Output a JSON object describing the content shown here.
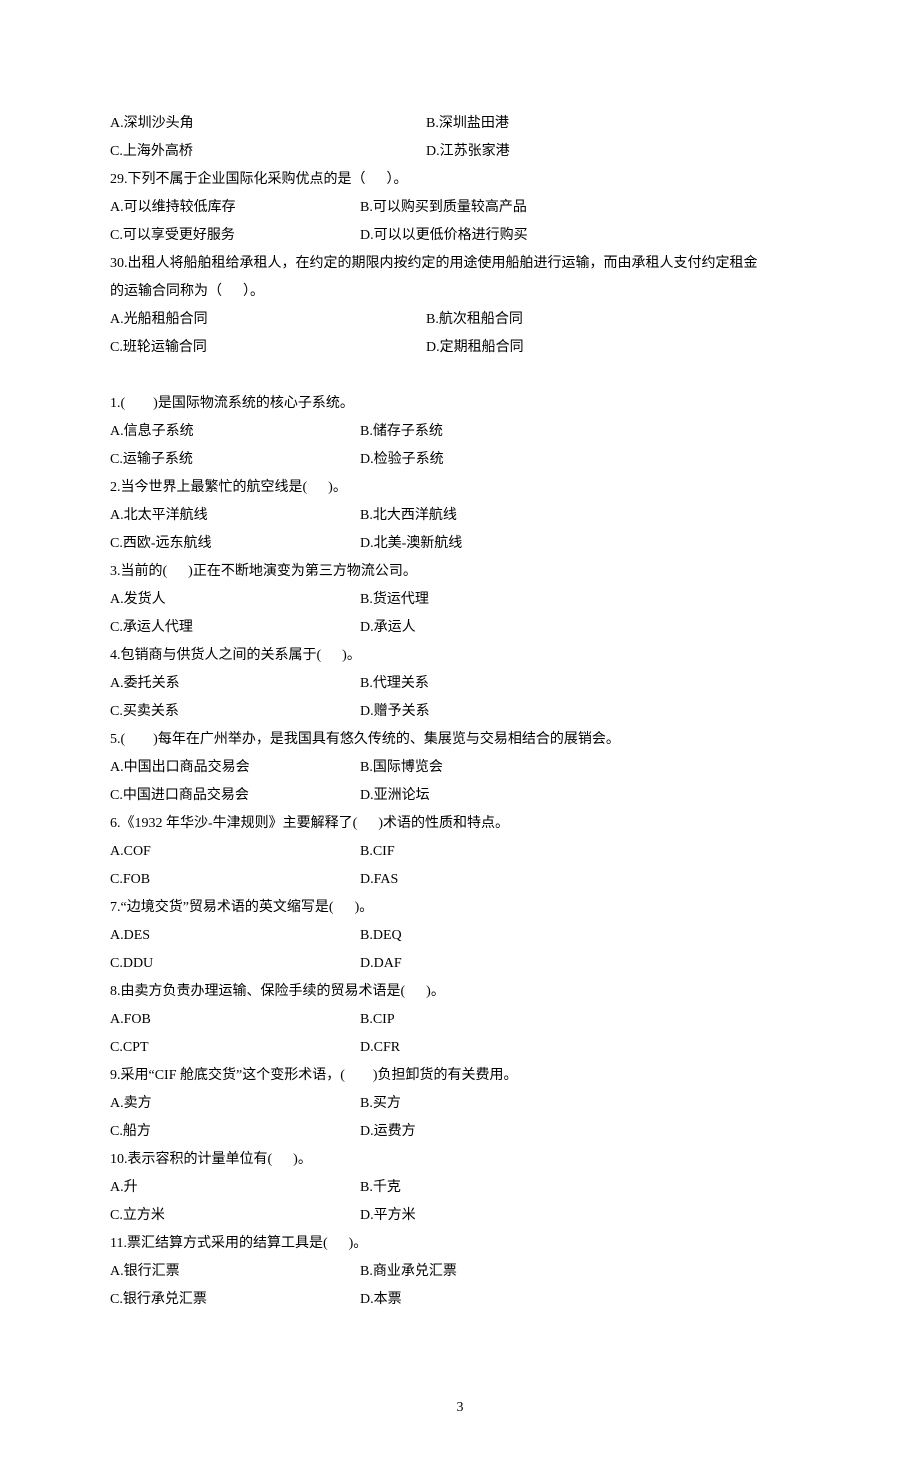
{
  "top": {
    "q28_A": "A.深圳沙头角",
    "q28_B": "B.深圳盐田港",
    "q28_C": "C.上海外高桥",
    "q28_D": "D.江苏张家港",
    "q29_stem": "29.下列不属于企业国际化采购优点的是（      ）。",
    "q29_A": "A.可以维持较低库存",
    "q29_B": "B.可以购买到质量较高产品",
    "q29_C": "C.可以享受更好服务",
    "q29_D": "D.可以以更低价格进行购买",
    "q30_stem1": "30.出租人将船舶租给承租人，在约定的期限内按约定的用途使用船舶进行运输，而由承租人支付约定租金",
    "q30_stem2": "的运输合同称为（      ）。",
    "q30_A": "A.光船租船合同",
    "q30_B": "B.航次租船合同",
    "q30_C": "C.班轮运输合同",
    "q30_D": "D.定期租船合同"
  },
  "q": [
    {
      "stem": "1.(        )是国际物流系统的核心子系统。",
      "A": "A.信息子系统",
      "B": "B.储存子系统",
      "C": "C.运输子系统",
      "D": "D.检验子系统"
    },
    {
      "stem": "2.当今世界上最繁忙的航空线是(      )。",
      "A": "A.北太平洋航线",
      "B": "B.北大西洋航线",
      "C": "C.西欧-远东航线",
      "D": "D.北美-澳新航线"
    },
    {
      "stem": "3.当前的(      )正在不断地演变为第三方物流公司。",
      "A": "A.发货人",
      "B": "B.货运代理",
      "C": "C.承运人代理",
      "D": "D.承运人"
    },
    {
      "stem": "4.包销商与供货人之间的关系属于(      )。",
      "A": "A.委托关系",
      "B": "B.代理关系",
      "C": "C.买卖关系",
      "D": "D.赠予关系"
    },
    {
      "stem": "5.(        )每年在广州举办，是我国具有悠久传统的、集展览与交易相结合的展销会。",
      "A": "A.中国出口商品交易会",
      "B": "B.国际博览会",
      "C": "C.中国进口商品交易会",
      "D": "D.亚洲论坛"
    },
    {
      "stem": "6.《1932 年华沙-牛津规则》主要解释了(      )术语的性质和特点。",
      "A": "A.COF",
      "B": "B.CIF",
      "C": "C.FOB",
      "D": "D.FAS"
    },
    {
      "stem": "7.“边境交货”贸易术语的英文缩写是(      )。",
      "A": "A.DES",
      "B": "B.DEQ",
      "C": "C.DDU",
      "D": "D.DAF"
    },
    {
      "stem": "8.由卖方负责办理运输、保险手续的贸易术语是(      )。",
      "A": "A.FOB",
      "B": "B.CIP",
      "C": "C.CPT",
      "D": "D.CFR"
    },
    {
      "stem": "9.采用“CIF 舱底交货”这个变形术语，(        )负担卸货的有关费用。",
      "A": "A.卖方",
      "B": "B.买方",
      "C": "C.船方",
      "D": "D.运费方"
    },
    {
      "stem": "10.表示容积的计量单位有(      )。",
      "A": "A.升",
      "B": "B.千克",
      "C": "C.立方米",
      "D": "D.平方米"
    },
    {
      "stem": "11.票汇结算方式采用的结算工具是(      )。",
      "A": "A.银行汇票",
      "B": "B.商业承兑汇票",
      "C": "C.银行承兑汇票",
      "D": "D.本票"
    }
  ],
  "page_number": "3"
}
